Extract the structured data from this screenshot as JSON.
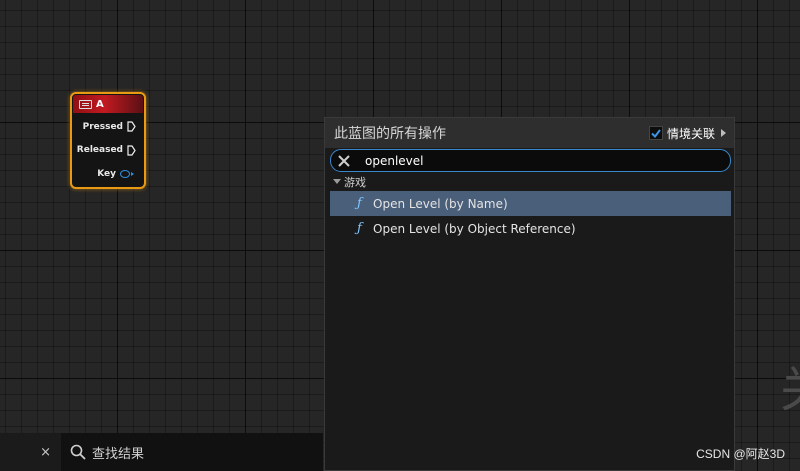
{
  "node": {
    "title": "A",
    "pins": [
      {
        "label": "Pressed",
        "type": "exec"
      },
      {
        "label": "Released",
        "type": "exec"
      },
      {
        "label": "Key",
        "type": "struct"
      }
    ],
    "colors": {
      "border": "#e89a14",
      "header": "#c01a20",
      "key_pin": "#2f8fe0"
    }
  },
  "menu": {
    "title": "此蓝图的所有操作",
    "context_sensitive": {
      "label": "情境关联",
      "checked": true
    },
    "search": {
      "value": "openlevel"
    },
    "category": "游戏",
    "items": [
      {
        "label": "Open Level (by Name)",
        "selected": true
      },
      {
        "label": "Open Level (by Object Reference)",
        "selected": false
      }
    ],
    "colors": {
      "selection": "#4a5f7a",
      "search_border": "#3b87cc",
      "function_icon": "#7ec6ff"
    }
  },
  "bottom_bar": {
    "close_label": "×",
    "find_results_label": "查找结果"
  },
  "watermark_glyph": "关",
  "watermark": "CSDN @阿赵3D"
}
